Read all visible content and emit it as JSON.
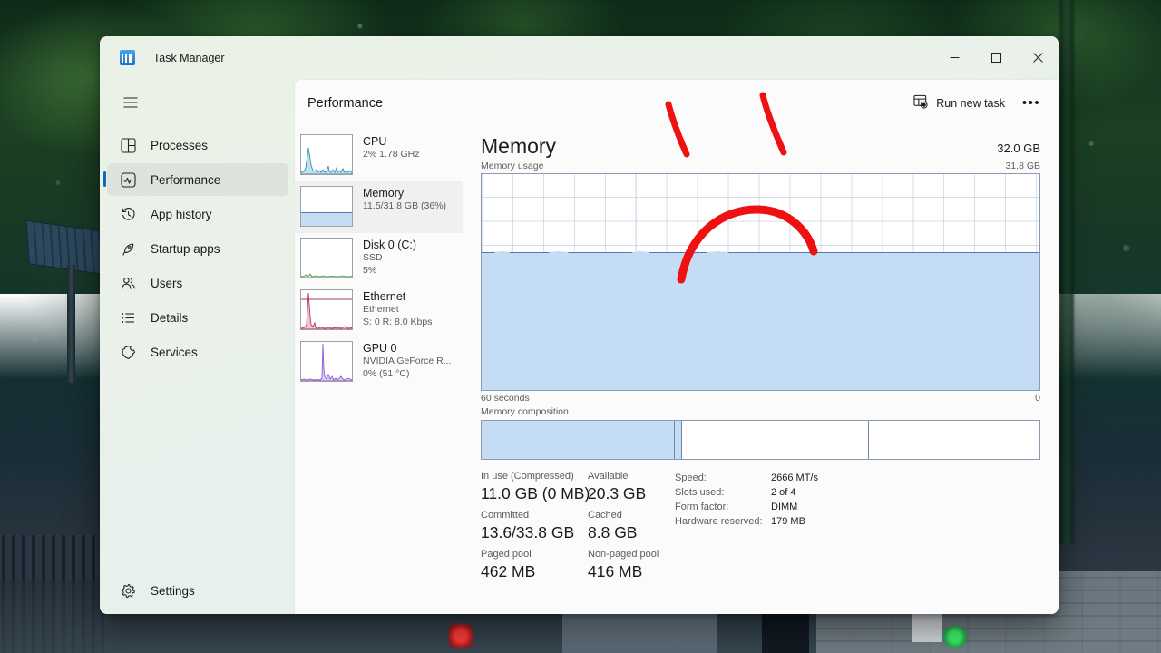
{
  "window": {
    "app_title": "Task Manager",
    "app_icon": "task-manager-icon",
    "controls": {
      "minimize": "minimize-icon",
      "maximize": "maximize-icon",
      "close": "close-icon"
    }
  },
  "sidebar": {
    "menu_icon": "hamburger-icon",
    "items": [
      {
        "label": "Processes",
        "icon": "processes-icon",
        "selected": false
      },
      {
        "label": "Performance",
        "icon": "performance-icon",
        "selected": true
      },
      {
        "label": "App history",
        "icon": "history-icon",
        "selected": false
      },
      {
        "label": "Startup apps",
        "icon": "rocket-icon",
        "selected": false
      },
      {
        "label": "Users",
        "icon": "users-icon",
        "selected": false
      },
      {
        "label": "Details",
        "icon": "list-icon",
        "selected": false
      },
      {
        "label": "Services",
        "icon": "services-icon",
        "selected": false
      }
    ],
    "settings": {
      "label": "Settings",
      "icon": "gear-icon"
    }
  },
  "header": {
    "title": "Performance",
    "run_new_task": "Run new task",
    "run_new_task_icon": "run-new-task-icon",
    "more_options": "•••"
  },
  "resources": [
    {
      "name": "CPU",
      "line1": "2%  1.78 GHz",
      "line2": "",
      "selected": false,
      "graph_color": "#3c8fb3",
      "thumb_type": "spikes"
    },
    {
      "name": "Memory",
      "line1": "11.5/31.8 GB (36%)",
      "line2": "",
      "selected": true,
      "graph_color": "#4a7bb5",
      "thumb_type": "fill",
      "fill_percent": 36
    },
    {
      "name": "Disk 0 (C:)",
      "line1": "SSD",
      "line2": "5%",
      "selected": false,
      "graph_color": "#2f7a3d",
      "thumb_type": "flat"
    },
    {
      "name": "Ethernet",
      "line1": "Ethernet",
      "line2": "S: 0 R: 8.0 Kbps",
      "selected": false,
      "graph_color": "#b5395f",
      "thumb_type": "peak"
    },
    {
      "name": "GPU 0",
      "line1": "NVIDIA GeForce R...",
      "line2": "0%  (51 °C)",
      "selected": false,
      "graph_color": "#8a5ad0",
      "thumb_type": "peak-purple"
    }
  ],
  "detail": {
    "title": "Memory",
    "total": "32.0 GB",
    "graph_label": "Memory usage",
    "graph_max": "31.8 GB",
    "graph_time_left": "60 seconds",
    "graph_time_right": "0",
    "composition_label": "Memory composition",
    "composition": {
      "in_use_percent": 34.5,
      "modified_percent": 1.2,
      "standby_percent": 33.5,
      "free_percent": 30.8
    },
    "usage_fill_percent": 64,
    "stats": [
      {
        "label": "In use (Compressed)",
        "value": "11.0 GB (0 MB)"
      },
      {
        "label": "Available",
        "value": "20.3 GB"
      },
      {
        "label": "Committed",
        "value": "13.6/33.8 GB"
      },
      {
        "label": "Cached",
        "value": "8.8 GB"
      },
      {
        "label": "Paged pool",
        "value": "462 MB"
      },
      {
        "label": "Non-paged pool",
        "value": "416 MB"
      }
    ],
    "hardware": [
      {
        "label": "Speed:",
        "value": "2666 MT/s"
      },
      {
        "label": "Slots used:",
        "value": "2 of 4"
      },
      {
        "label": "Form factor:",
        "value": "DIMM"
      },
      {
        "label": "Hardware reserved:",
        "value": "179 MB"
      }
    ]
  },
  "annotations": {
    "color": "#ee1111",
    "marks": [
      {
        "kind": "stroke-left",
        "name": "red-tick-left"
      },
      {
        "kind": "stroke-right",
        "name": "red-tick-right"
      },
      {
        "kind": "arc",
        "name": "red-arc"
      }
    ]
  }
}
